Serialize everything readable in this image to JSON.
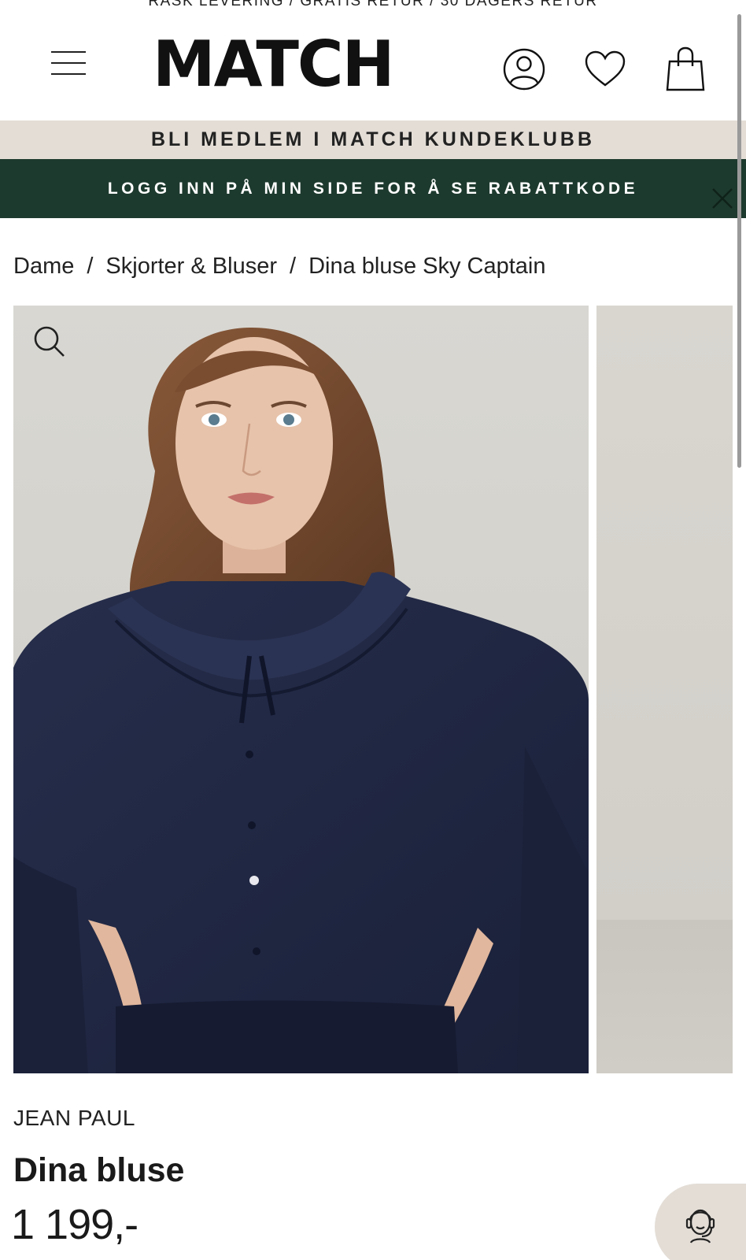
{
  "top_strip": {
    "text": "RASK LEVERING / GRATIS RETUR / 30 DAGERS RETUR"
  },
  "header": {
    "logo_text": "MATCH",
    "icons": [
      "menu-icon",
      "user-icon",
      "heart-icon",
      "shopping-bag-icon"
    ]
  },
  "club_banner": {
    "text": "BLI MEDLEM I MATCH KUNDEKLUBB"
  },
  "login_banner": {
    "text": "LOGG INN PÅ MIN SIDE FOR Å SE RABATTKODE",
    "close_icon": "close-icon"
  },
  "breadcrumb": {
    "items": [
      "Dame",
      "Skjorter & Bluser",
      "Dina bluse Sky Captain"
    ],
    "separator": "/"
  },
  "gallery": {
    "zoom_icon": "search-icon"
  },
  "product": {
    "brand": "JEAN PAUL",
    "name": "Dina bluse",
    "price": "1 199,-"
  },
  "chat": {
    "icon": "customer-service-icon"
  },
  "colors": {
    "club_banner_bg": "#e3ddd6",
    "login_banner_bg": "#1d3a2e",
    "blouse_navy": "#1f2640"
  }
}
